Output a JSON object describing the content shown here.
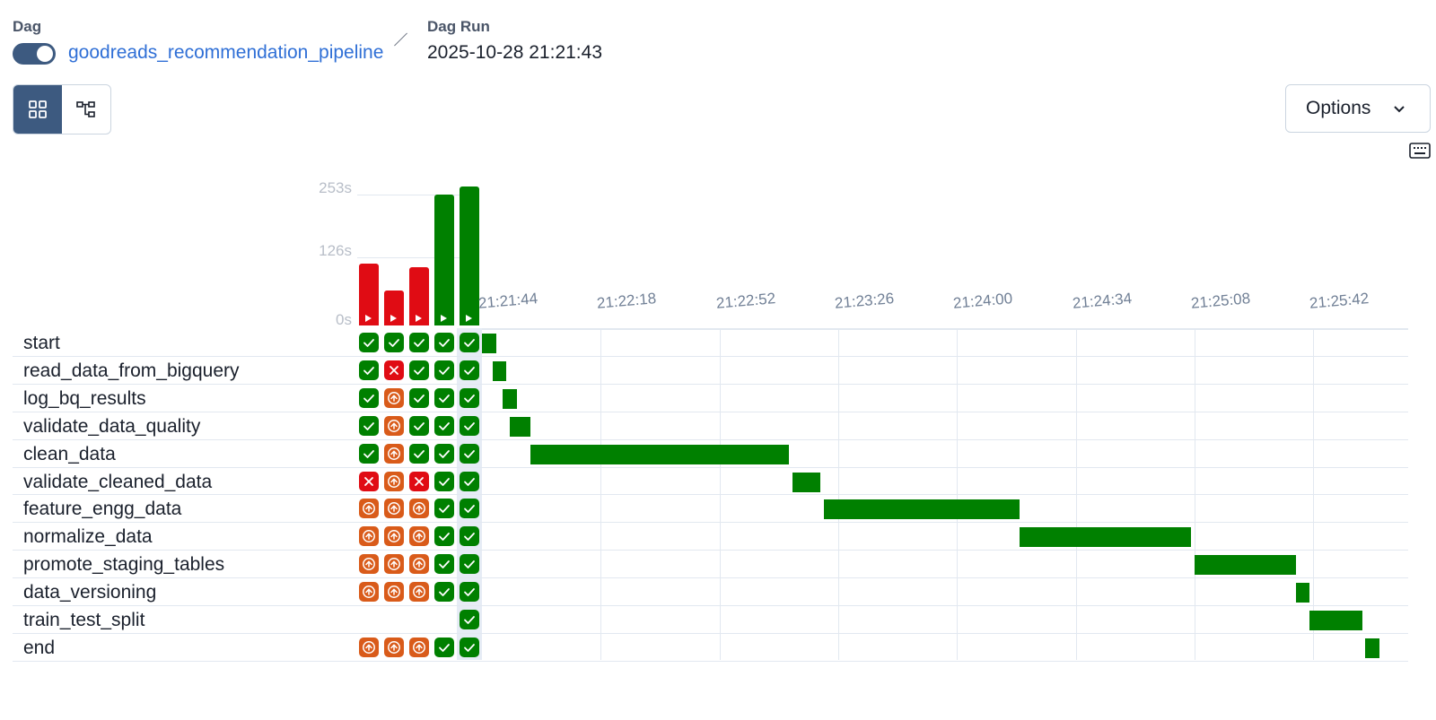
{
  "header": {
    "dag_label": "Dag",
    "dag_name": "goodreads_recommendation_pipeline",
    "run_label": "Dag Run",
    "run_id": "2025-10-28 21:21:43"
  },
  "toolbar": {
    "options_label": "Options"
  },
  "colors": {
    "success": "#008000",
    "failed": "#e00c14",
    "upstream_failed": "#d95b1a",
    "accent": "#3d5a80",
    "link": "#2f6fd6"
  },
  "chart_data": {
    "type": "bar",
    "y_ticks": [
      "253s",
      "126s",
      "0s"
    ],
    "ylim": [
      0,
      253
    ],
    "runs": [
      {
        "duration_s": 112,
        "state": "failed"
      },
      {
        "duration_s": 64,
        "state": "failed"
      },
      {
        "duration_s": 106,
        "state": "failed"
      },
      {
        "duration_s": 238,
        "state": "success"
      },
      {
        "duration_s": 253,
        "state": "success"
      }
    ]
  },
  "time_axis": {
    "ticks": [
      "21:21:44",
      "21:22:18",
      "21:22:52",
      "21:23:26",
      "21:24:00",
      "21:24:34",
      "21:25:08",
      "21:25:42"
    ]
  },
  "tasks": [
    {
      "name": "start",
      "states": [
        "success",
        "success",
        "success",
        "success",
        "success"
      ],
      "start_s": 0,
      "end_s": 4
    },
    {
      "name": "read_data_from_bigquery",
      "states": [
        "success",
        "failed",
        "success",
        "success",
        "success"
      ],
      "start_s": 3,
      "end_s": 7
    },
    {
      "name": "log_bq_results",
      "states": [
        "success",
        "upstream_failed",
        "success",
        "success",
        "success"
      ],
      "start_s": 6,
      "end_s": 10
    },
    {
      "name": "validate_data_quality",
      "states": [
        "success",
        "upstream_failed",
        "success",
        "success",
        "success"
      ],
      "start_s": 8,
      "end_s": 14
    },
    {
      "name": "clean_data",
      "states": [
        "success",
        "upstream_failed",
        "success",
        "success",
        "success"
      ],
      "start_s": 14,
      "end_s": 88
    },
    {
      "name": "validate_cleaned_data",
      "states": [
        "failed",
        "upstream_failed",
        "failed",
        "success",
        "success"
      ],
      "start_s": 89,
      "end_s": 97
    },
    {
      "name": "feature_engg_data",
      "states": [
        "upstream_failed",
        "upstream_failed",
        "upstream_failed",
        "success",
        "success"
      ],
      "start_s": 98,
      "end_s": 154
    },
    {
      "name": "normalize_data",
      "states": [
        "upstream_failed",
        "upstream_failed",
        "upstream_failed",
        "success",
        "success"
      ],
      "start_s": 154,
      "end_s": 203
    },
    {
      "name": "promote_staging_tables",
      "states": [
        "upstream_failed",
        "upstream_failed",
        "upstream_failed",
        "success",
        "success"
      ],
      "start_s": 204,
      "end_s": 233
    },
    {
      "name": "data_versioning",
      "states": [
        "upstream_failed",
        "upstream_failed",
        "upstream_failed",
        "success",
        "success"
      ],
      "start_s": 233,
      "end_s": 237
    },
    {
      "name": "train_test_split",
      "states": [
        null,
        null,
        null,
        null,
        "success"
      ],
      "start_s": 237,
      "end_s": 252
    },
    {
      "name": "end",
      "states": [
        "upstream_failed",
        "upstream_failed",
        "upstream_failed",
        "success",
        "success"
      ],
      "start_s": 253,
      "end_s": 257
    }
  ]
}
